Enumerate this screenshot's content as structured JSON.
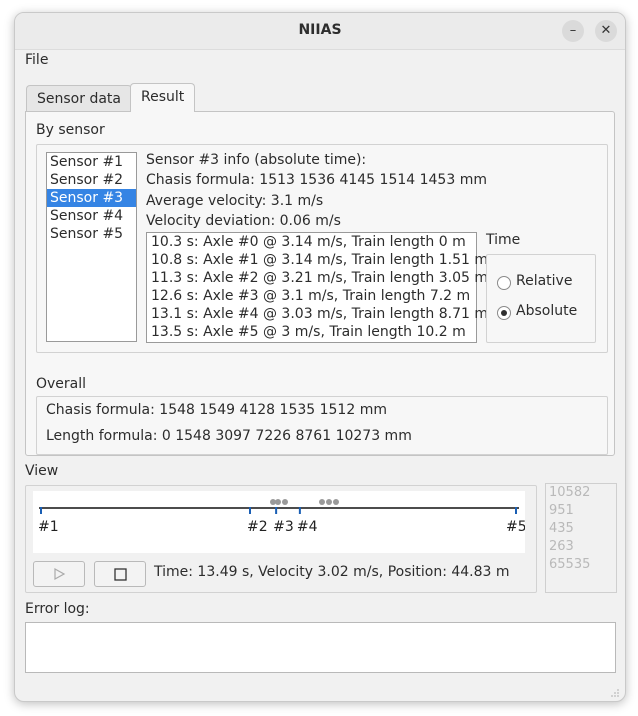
{
  "window": {
    "title": "NIIAS"
  },
  "controls": {
    "minimize": "–",
    "close": "✕"
  },
  "menu": {
    "file": "File"
  },
  "tabs": [
    {
      "label": "Sensor data",
      "active": false
    },
    {
      "label": "Result",
      "active": true
    }
  ],
  "by_sensor": {
    "label": "By sensor",
    "sensors": [
      "Sensor #1",
      "Sensor #2",
      "Sensor #3",
      "Sensor #4",
      "Sensor #5"
    ],
    "selected_index": 2,
    "info_title": "Sensor #3 info (absolute time):",
    "chasis_formula": "Chasis formula: 1513 1536 4145 1514 1453 mm",
    "average_velocity": "Average velocity: 3.1 m/s",
    "velocity_deviation": "Velocity deviation: 0.06 m/s",
    "events": [
      "10.3 s: Axle #0 @ 3.14 m/s, Train length 0 m",
      "10.8 s: Axle #1 @ 3.14 m/s, Train length 1.51 m",
      "11.3 s: Axle #2 @ 3.21 m/s, Train length 3.05 m",
      "12.6 s: Axle #3 @ 3.1 m/s, Train length 7.2 m",
      "13.1 s: Axle #4 @ 3.03 m/s, Train length 8.71 m",
      "13.5 s: Axle #5 @ 3 m/s, Train length 10.2 m"
    ]
  },
  "time_group": {
    "label": "Time",
    "options": [
      "Relative",
      "Absolute"
    ],
    "selected": "Absolute"
  },
  "overall": {
    "label": "Overall",
    "chasis_formula": "Chasis formula: 1548 1549 4128 1535 1512 mm",
    "length_formula": "Length formula: 0 1548 3097 7226 8761 10273 mm"
  },
  "view": {
    "label": "View",
    "track_labels": [
      "#1",
      "#2",
      "#3",
      "#4",
      "#5"
    ],
    "track_positions_fraction": [
      0.0,
      0.44,
      0.495,
      0.545,
      1.0
    ],
    "accent_color": "#1a5fb4",
    "status": "Time: 13.49 s, Velocity 3.02 m/s, Position: 44.83 m",
    "play_icon": "play-icon",
    "stop_icon": "stop-icon",
    "side_values": [
      "10582",
      "951",
      "435",
      "263",
      "65535"
    ]
  },
  "error_log": {
    "label": "Error log:",
    "content": ""
  }
}
